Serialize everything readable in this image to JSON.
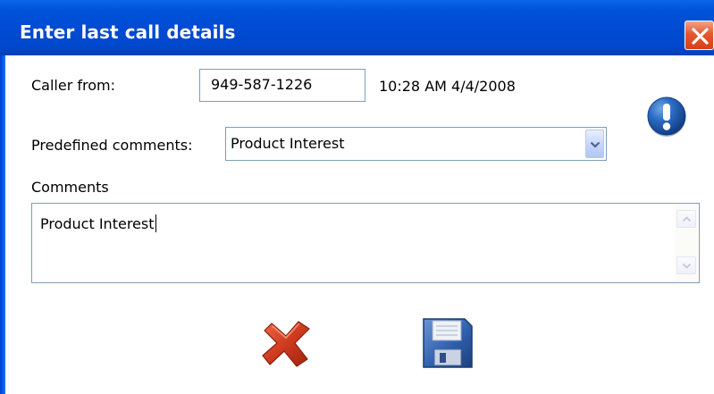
{
  "window": {
    "title": "Enter last call details",
    "close_icon": "close-x-icon"
  },
  "caller": {
    "label": "Caller from:",
    "phone": "949-587-1226",
    "datetime": "10:28 AM 4/4/2008"
  },
  "predefined": {
    "label": "Predefined comments:",
    "selected": "Product Interest",
    "arrow_icon": "chevron-down-icon"
  },
  "comments": {
    "label": "Comments",
    "value": "Product Interest"
  },
  "icons": {
    "info": "exclamation-info-icon",
    "cancel": "red-x-cancel-icon",
    "save": "floppy-disk-save-icon"
  },
  "colors": {
    "titlebar": "#0052d9",
    "close_button": "#e5572e",
    "field_border": "#7f9db9",
    "info_icon": "#1f5ba8",
    "cancel_icon": "#c8321e",
    "save_icon": "#2e5fa8"
  }
}
